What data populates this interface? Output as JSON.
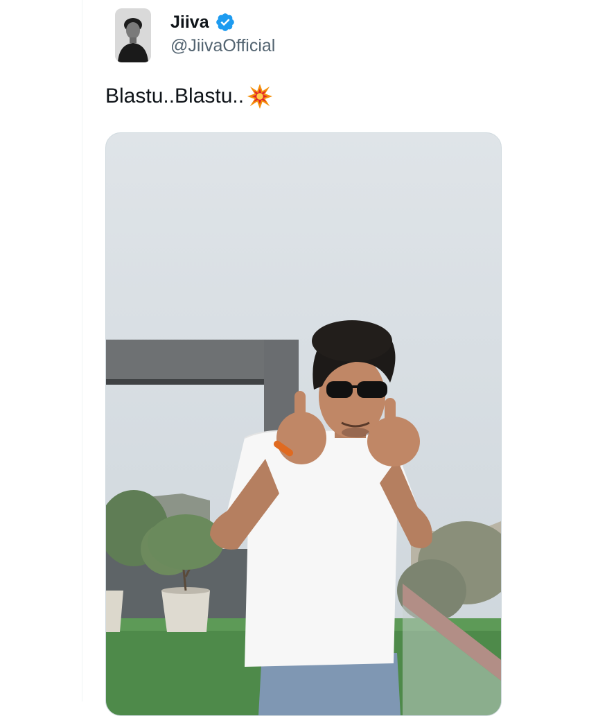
{
  "tweet": {
    "author": {
      "display_name": "Jiiva",
      "handle": "@JiivaOfficial",
      "verified": true,
      "verified_color": "#1d9bf0"
    },
    "text": "Blastu..Blastu..",
    "emoji": "collision-icon",
    "media": {
      "type": "photo"
    }
  }
}
